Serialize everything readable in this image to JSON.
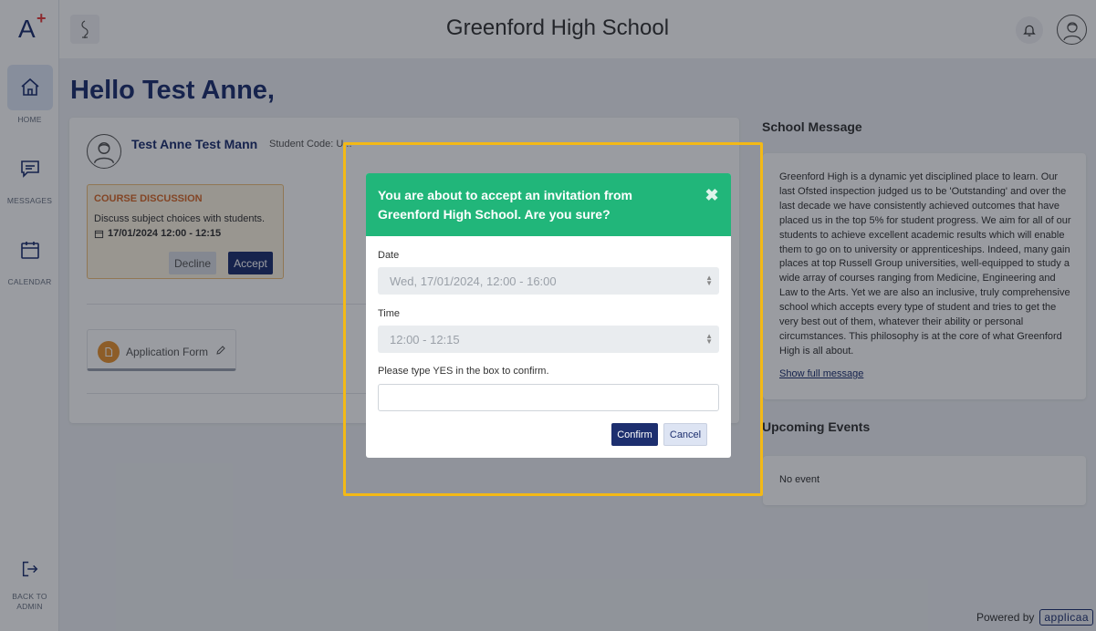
{
  "sidebar": {
    "logo": "A",
    "logo_plus": "+",
    "items": [
      {
        "label": "HOME",
        "icon": "home-icon"
      },
      {
        "label": "MESSAGES",
        "icon": "message-icon"
      },
      {
        "label": "CALENDAR",
        "icon": "calendar-icon"
      }
    ],
    "back_label_1": "BACK TO",
    "back_label_2": "ADMIN"
  },
  "header": {
    "title": "Greenford High School"
  },
  "greeting": "Hello Test Anne,",
  "student": {
    "name": "Test Anne Test Mann",
    "code_label": "Student Code: U...",
    "course": {
      "title": "COURSE DISCUSSION",
      "description": "Discuss subject choices with students.",
      "datetime": "17/01/2024 12:00 - 12:15",
      "decline_label": "Decline",
      "accept_label": "Accept"
    },
    "application_form_label": "Application Form"
  },
  "school_message": {
    "title": "School Message",
    "body": "Greenford High is a dynamic yet disciplined place to learn. Our last Ofsted inspection judged us to be 'Outstanding' and over the last decade we have consistently achieved outcomes that have placed us in the top 5% for student progress. We aim for all of our students to achieve excellent academic results which will enable them to go on to university or apprenticeships. Indeed, many gain places at top Russell Group universities, well-equipped to study a wide array of courses ranging from Medicine, Engineering and Law to the Arts. Yet we are also an inclusive, truly comprehensive school which accepts every type of student and tries to get the very best out of them, whatever their ability or personal circumstances. This philosophy is at the core of what Greenford High is all about.",
    "link": "Show full message"
  },
  "upcoming_events": {
    "title": "Upcoming Events",
    "empty_text": "No event"
  },
  "footer": {
    "powered_by": "Powered by",
    "brand": "applicaa"
  },
  "modal": {
    "title": "You are about to accept an invitation from Greenford High School. Are you sure?",
    "close_symbol": "✖",
    "date_label": "Date",
    "date_value": "Wed, 17/01/2024, 12:00 - 16:00",
    "time_label": "Time",
    "time_value": "12:00 - 12:15",
    "confirm_prompt": "Please type YES in the box to confirm.",
    "confirm_label": "Confirm",
    "cancel_label": "Cancel"
  },
  "colors": {
    "brand_navy": "#1d2f6f",
    "modal_header_green": "#21b67a",
    "highlight_yellow": "#f3b916",
    "course_orange": "#d86a2a"
  }
}
